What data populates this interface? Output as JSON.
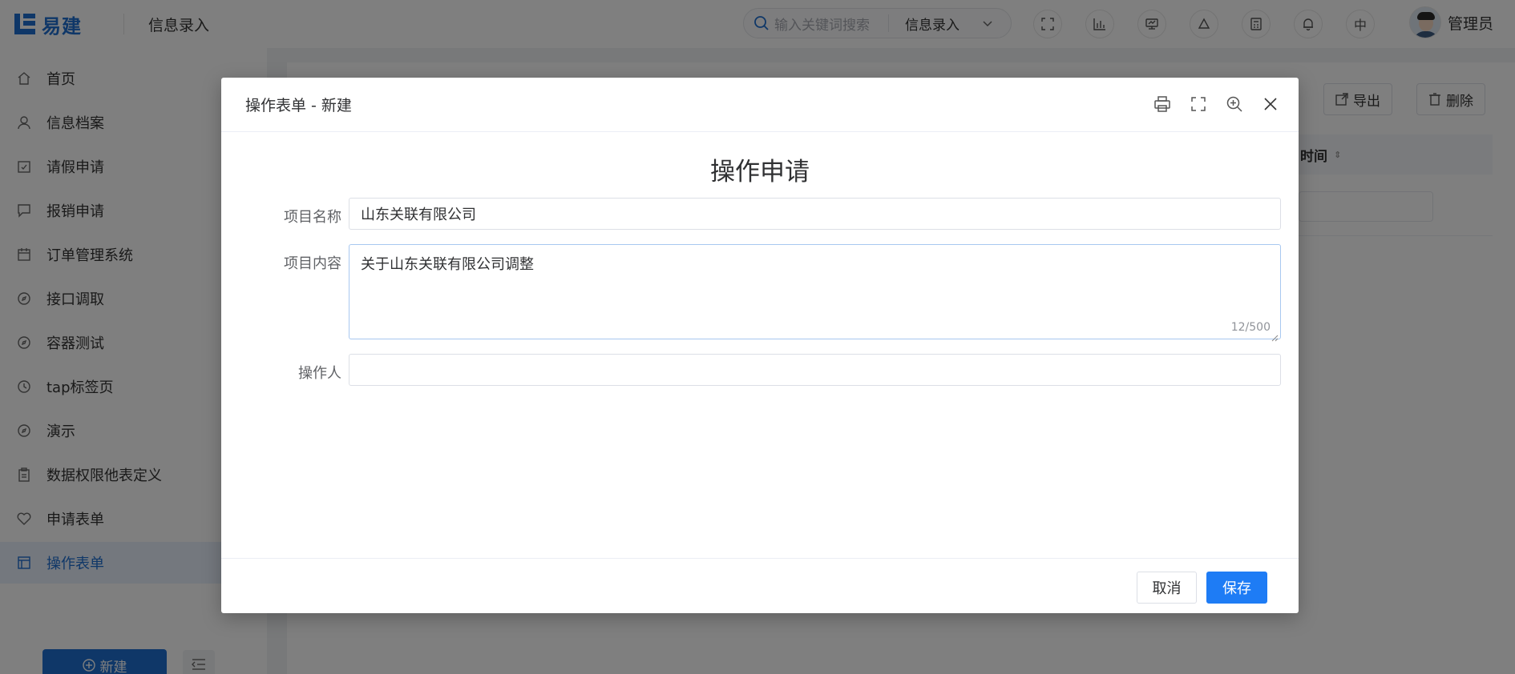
{
  "app": {
    "brand": "易建",
    "title": "信息录入"
  },
  "search": {
    "placeholder": "输入关键词搜索",
    "scope": "信息录入"
  },
  "header_icons": [
    "fullscreen-icon",
    "bar-chart-icon",
    "monitor-icon",
    "recycle-icon",
    "calculator-icon",
    "bell-icon"
  ],
  "language": "中",
  "user": {
    "name": "管理员"
  },
  "sidebar": {
    "items": [
      {
        "label": "首页",
        "icon": "home-icon"
      },
      {
        "label": "信息档案",
        "icon": "user-icon"
      },
      {
        "label": "请假申请",
        "icon": "calendar-check-icon"
      },
      {
        "label": "报销申请",
        "icon": "chat-icon"
      },
      {
        "label": "订单管理系统",
        "icon": "calendar-icon"
      },
      {
        "label": "接口调取",
        "icon": "compass-icon"
      },
      {
        "label": "容器测试",
        "icon": "compass-icon"
      },
      {
        "label": "tap标签页",
        "icon": "clock-icon"
      },
      {
        "label": "演示",
        "icon": "compass-icon"
      },
      {
        "label": "数据权限他表定义",
        "icon": "clipboard-icon"
      },
      {
        "label": "申请表单",
        "icon": "heart-icon"
      },
      {
        "label": "操作表单",
        "icon": "form-icon",
        "active": true
      }
    ],
    "new_label": "新建"
  },
  "background": {
    "export_label": "导出",
    "delete_label": "删除",
    "column_fragment": "时间"
  },
  "dialog": {
    "title": "操作表单 - 新建",
    "form_title": "操作申请",
    "fields": {
      "project_name": {
        "label": "项目名称",
        "value": "山东关联有限公司"
      },
      "project_content": {
        "label": "项目内容",
        "value": "关于山东关联有限公司调整",
        "counter": "12/500"
      },
      "operator": {
        "label": "操作人",
        "value": ""
      }
    },
    "cancel_label": "取消",
    "save_label": "保存"
  },
  "colors": {
    "primary": "#1f6fd1",
    "save": "#1e7cf5",
    "active_bg": "#e8f1fd"
  }
}
